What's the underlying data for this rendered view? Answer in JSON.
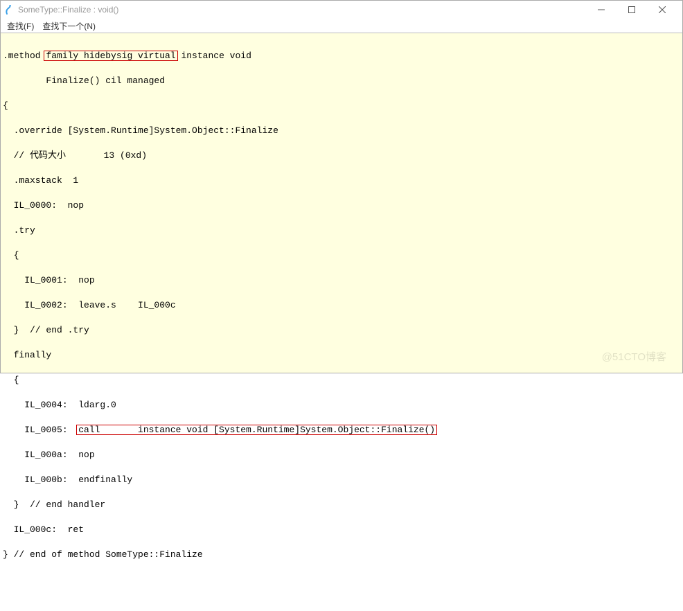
{
  "window": {
    "title": "SomeType::Finalize : void()"
  },
  "menu": {
    "find": "查找(F)",
    "findNext": "查找下一个(N)"
  },
  "code": {
    "l1_a": ".method ",
    "l1_b": "family hidebysig virtual",
    "l1_c": " instance void",
    "l2": "        Finalize() cil managed",
    "l3": "{",
    "l4": "  .override [System.Runtime]System.Object::Finalize",
    "l5": "  // 代码大小       13 (0xd)",
    "l6": "  .maxstack  1",
    "l7": "  IL_0000:  nop",
    "l8": "  .try",
    "l9": "  {",
    "l10": "    IL_0001:  nop",
    "l11": "    IL_0002:  leave.s    IL_000c",
    "l12": "  }  // end .try",
    "l13": "  finally",
    "l14": "  {",
    "l15": "    IL_0004:  ldarg.0",
    "l16_a": "    IL_0005:  ",
    "l16_b": "call       instance void [System.Runtime]System.Object::Finalize()",
    "l17": "    IL_000a:  nop",
    "l18": "    IL_000b:  endfinally",
    "l19": "  }  // end handler",
    "l20": "  IL_000c:  ret",
    "l21": "} // end of method SomeType::Finalize"
  },
  "watermark": "@51CTO博客"
}
